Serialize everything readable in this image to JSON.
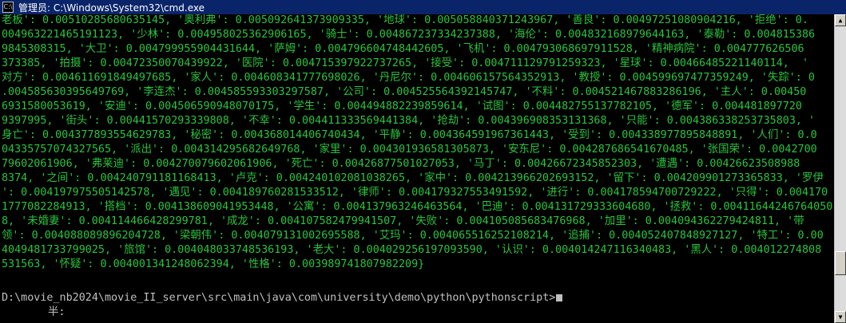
{
  "window": {
    "title": "管理员: C:\\Windows\\System32\\cmd.exe",
    "icon": "cmd-icon"
  },
  "console": {
    "lines": [
      "老板': 0.00510285680635145, '奥利弗': 0.005092641373909335, '地球': 0.005058840371243967, '善良': 0.00497251080904216, '拒绝': 0.",
      "004963221465191123, '少林': 0.004958025362906165, '骑士': 0.004867237334237388, '海伦': 0.004832168979644163, '泰勒': 0.004815386",
      "9845308315, '大卫': 0.004799955904431644, '萨姆': 0.004796604748442605, '飞机': 0.004793068697911528, '精神病院': 0.004777626506",
      "373385, '拍摄': 0.00472350070439922, '医院': 0.004715397922737265, '接受': 0.004711129791259323, '星球': 0.00466485221140114,  '",
      "对方': 0.004611691849497685, '家人': 0.004608341777698026, '丹尼尔': 0.004606157564352913, '教授': 0.004599697477359249, '失踪': 0",
      ".004585630395649769, '李连杰': 0.004585593303297587, '公司': 0.004525564392145747, '不料': 0.004521467883286196, '主人': 0.00450",
      "6931580053619, '安迪': 0.004506590948070175, '学生': 0.004494882239859614, '试图': 0.004482755137782105, '德军': 0.004481897720",
      "9397995, '街头': 0.00441570293339808, '不幸': 0.004411333569441384, '抢劫': 0.004396908353131368, '只能': 0.004386338253735803, '",
      "身亡': 0.004377893554629783, '秘密': 0.004368014406740434, '平静': 0.004364591967361443, '受到': 0.004338977895848891, '人们': 0.0",
      "04335757074327565, '派出': 0.004314295682649768, '家里': 0.004301936581305873, '安东尼': 0.004287686541670485, '张国荣': 0.0042700",
      "79602061906, '弗莱迪': 0.004270079602061906, '死亡': 0.00426877501027053, '马丁': 0.00426672345852303, '遭遇': 0.00426623508988",
      "8374, '之间': 0.004240791181168413, '卢克': 0.004240102081038265, '家中': 0.004213966202693152, '留下': 0.004209901273365833, '罗伊",
      "': 0.004197975505142578, '遇见': 0.004189760281533512, '律师': 0.004179327553491592, '进行': 0.004178594700729222, '只得': 0.004170",
      "1777082284913, '搭档': 0.004138609041953448, '公寓': 0.004137963246463564, '巴迪': 0.004131729333604680, '拯救': 0.00411644246764050",
      "8, '未婚妻': 0.004114466428299781, '成龙': 0.004107582479941507, '失败': 0.004105085683476968, '加里': 0.004094362279424811, '带",
      "领': 0.004088089896204728, '梁朝伟': 0.004079131002695588, '艾玛': 0.004065516252108214, '追捕': 0.004052407848927127, '特工': 0.00",
      "4049481733799025, '旅馆': 0.004048033748536193, '老大': 0.004029256197093590, '认识': 0.004014247116340483, '黑人': 0.004012274808",
      "531563, '怀疑': 0.004001341248062394, '性格': 0.003989741807982209}"
    ],
    "prompt": "D:\\movie_nb2024\\movie_II_server\\src\\main\\java\\com\\university\\demo\\python\\pythonscript>",
    "ime_status": "半:"
  },
  "colors": {
    "output_text": "#2bc33d",
    "prompt_text": "#c0c0c0",
    "background": "#000000",
    "titlebar": "#0a246a"
  },
  "scrollbar": {
    "up_icon": "arrow-up-icon",
    "down_icon": "arrow-down-icon"
  }
}
